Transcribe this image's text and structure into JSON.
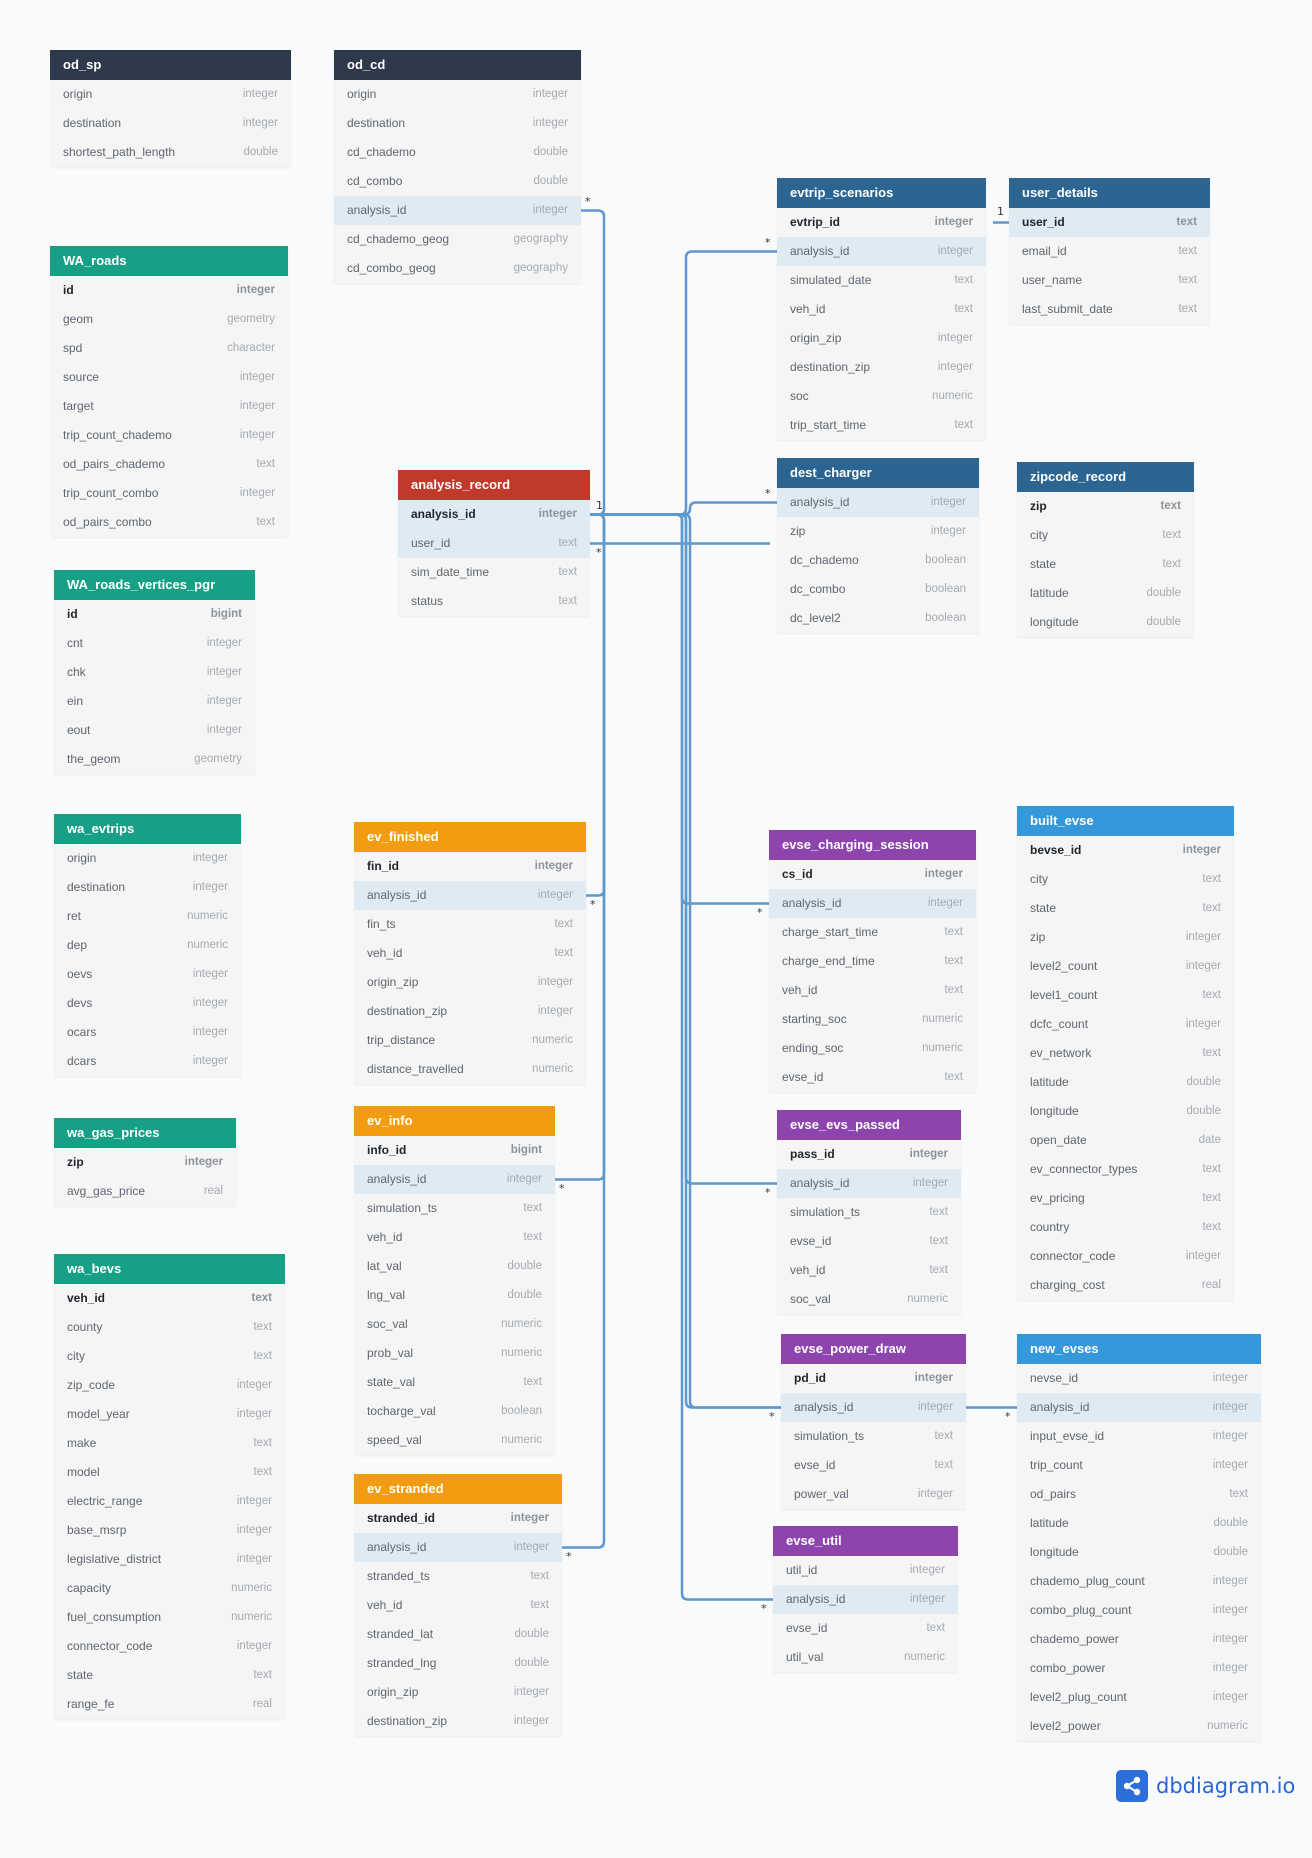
{
  "colors": {
    "navy": "#2e3a4b",
    "teal": "#17a085",
    "red": "#c0392b",
    "blue": "#2c6592",
    "orange": "#f39c12",
    "purple": "#8e44ad",
    "sky": "#3498db",
    "line": "#5e98cd"
  },
  "tables": [
    {
      "key": "od_sp",
      "name": "od_sp",
      "color": "navy",
      "columns": [
        {
          "name": "origin",
          "type": "integer"
        },
        {
          "name": "destination",
          "type": "integer"
        },
        {
          "name": "shortest_path_length",
          "type": "double"
        }
      ]
    },
    {
      "key": "od_cd",
      "name": "od_cd",
      "color": "navy",
      "columns": [
        {
          "name": "origin",
          "type": "integer"
        },
        {
          "name": "destination",
          "type": "integer"
        },
        {
          "name": "cd_chademo",
          "type": "double"
        },
        {
          "name": "cd_combo",
          "type": "double"
        },
        {
          "name": "analysis_id",
          "type": "integer",
          "hl": true
        },
        {
          "name": "cd_chademo_geog",
          "type": "geography"
        },
        {
          "name": "cd_combo_geog",
          "type": "geography"
        }
      ]
    },
    {
      "key": "evtrip_scenarios",
      "name": "evtrip_scenarios",
      "color": "blue",
      "columns": [
        {
          "name": "evtrip_id",
          "type": "integer",
          "pk": true
        },
        {
          "name": "analysis_id",
          "type": "integer",
          "hl": true
        },
        {
          "name": "simulated_date",
          "type": "text"
        },
        {
          "name": "veh_id",
          "type": "text"
        },
        {
          "name": "origin_zip",
          "type": "integer"
        },
        {
          "name": "destination_zip",
          "type": "integer"
        },
        {
          "name": "soc",
          "type": "numeric"
        },
        {
          "name": "trip_start_time",
          "type": "text"
        }
      ]
    },
    {
      "key": "user_details",
      "name": "user_details",
      "color": "blue",
      "columns": [
        {
          "name": "user_id",
          "type": "text",
          "pk": true,
          "hl": true
        },
        {
          "name": "email_id",
          "type": "text"
        },
        {
          "name": "user_name",
          "type": "text"
        },
        {
          "name": "last_submit_date",
          "type": "text"
        }
      ]
    },
    {
      "key": "WA_roads",
      "name": "WA_roads",
      "color": "teal",
      "columns": [
        {
          "name": "id",
          "type": "integer",
          "pk": true
        },
        {
          "name": "geom",
          "type": "geometry"
        },
        {
          "name": "spd",
          "type": "character"
        },
        {
          "name": "source",
          "type": "integer"
        },
        {
          "name": "target",
          "type": "integer"
        },
        {
          "name": "trip_count_chademo",
          "type": "integer"
        },
        {
          "name": "od_pairs_chademo",
          "type": "text"
        },
        {
          "name": "trip_count_combo",
          "type": "integer"
        },
        {
          "name": "od_pairs_combo",
          "type": "text"
        }
      ]
    },
    {
      "key": "analysis_record",
      "name": "analysis_record",
      "color": "red",
      "columns": [
        {
          "name": "analysis_id",
          "type": "integer",
          "pk": true,
          "hl": true
        },
        {
          "name": "user_id",
          "type": "text",
          "hl": true
        },
        {
          "name": "sim_date_time",
          "type": "text"
        },
        {
          "name": "status",
          "type": "text"
        }
      ]
    },
    {
      "key": "dest_charger",
      "name": "dest_charger",
      "color": "blue",
      "columns": [
        {
          "name": "analysis_id",
          "type": "integer",
          "hl": true
        },
        {
          "name": "zip",
          "type": "integer"
        },
        {
          "name": "dc_chademo",
          "type": "boolean"
        },
        {
          "name": "dc_combo",
          "type": "boolean"
        },
        {
          "name": "dc_level2",
          "type": "boolean"
        }
      ]
    },
    {
      "key": "zipcode_record",
      "name": "zipcode_record",
      "color": "blue",
      "columns": [
        {
          "name": "zip",
          "type": "text",
          "pk": true
        },
        {
          "name": "city",
          "type": "text"
        },
        {
          "name": "state",
          "type": "text"
        },
        {
          "name": "latitude",
          "type": "double"
        },
        {
          "name": "longitude",
          "type": "double"
        }
      ]
    },
    {
      "key": "WA_roads_vertices_pgr",
      "name": "WA_roads_vertices_pgr",
      "color": "teal",
      "columns": [
        {
          "name": "id",
          "type": "bigint",
          "pk": true
        },
        {
          "name": "cnt",
          "type": "integer"
        },
        {
          "name": "chk",
          "type": "integer"
        },
        {
          "name": "ein",
          "type": "integer"
        },
        {
          "name": "eout",
          "type": "integer"
        },
        {
          "name": "the_geom",
          "type": "geometry"
        }
      ]
    },
    {
      "key": "wa_evtrips",
      "name": "wa_evtrips",
      "color": "teal",
      "columns": [
        {
          "name": "origin",
          "type": "integer"
        },
        {
          "name": "destination",
          "type": "integer"
        },
        {
          "name": "ret",
          "type": "numeric"
        },
        {
          "name": "dep",
          "type": "numeric"
        },
        {
          "name": "oevs",
          "type": "integer"
        },
        {
          "name": "devs",
          "type": "integer"
        },
        {
          "name": "ocars",
          "type": "integer"
        },
        {
          "name": "dcars",
          "type": "integer"
        }
      ]
    },
    {
      "key": "ev_finished",
      "name": "ev_finished",
      "color": "orange",
      "columns": [
        {
          "name": "fin_id",
          "type": "integer",
          "pk": true
        },
        {
          "name": "analysis_id",
          "type": "integer",
          "hl": true
        },
        {
          "name": "fin_ts",
          "type": "text"
        },
        {
          "name": "veh_id",
          "type": "text"
        },
        {
          "name": "origin_zip",
          "type": "integer"
        },
        {
          "name": "destination_zip",
          "type": "integer"
        },
        {
          "name": "trip_distance",
          "type": "numeric"
        },
        {
          "name": "distance_travelled",
          "type": "numeric"
        }
      ]
    },
    {
      "key": "evse_charging_session",
      "name": "evse_charging_session",
      "color": "purple",
      "columns": [
        {
          "name": "cs_id",
          "type": "integer",
          "pk": true
        },
        {
          "name": "analysis_id",
          "type": "integer",
          "hl": true
        },
        {
          "name": "charge_start_time",
          "type": "text"
        },
        {
          "name": "charge_end_time",
          "type": "text"
        },
        {
          "name": "veh_id",
          "type": "text"
        },
        {
          "name": "starting_soc",
          "type": "numeric"
        },
        {
          "name": "ending_soc",
          "type": "numeric"
        },
        {
          "name": "evse_id",
          "type": "text"
        }
      ]
    },
    {
      "key": "built_evse",
      "name": "built_evse",
      "color": "sky",
      "columns": [
        {
          "name": "bevse_id",
          "type": "integer",
          "pk": true
        },
        {
          "name": "city",
          "type": "text"
        },
        {
          "name": "state",
          "type": "text"
        },
        {
          "name": "zip",
          "type": "integer"
        },
        {
          "name": "level2_count",
          "type": "integer"
        },
        {
          "name": "level1_count",
          "type": "text"
        },
        {
          "name": "dcfc_count",
          "type": "integer"
        },
        {
          "name": "ev_network",
          "type": "text"
        },
        {
          "name": "latitude",
          "type": "double"
        },
        {
          "name": "longitude",
          "type": "double"
        },
        {
          "name": "open_date",
          "type": "date"
        },
        {
          "name": "ev_connector_types",
          "type": "text"
        },
        {
          "name": "ev_pricing",
          "type": "text"
        },
        {
          "name": "country",
          "type": "text"
        },
        {
          "name": "connector_code",
          "type": "integer"
        },
        {
          "name": "charging_cost",
          "type": "real"
        }
      ]
    },
    {
      "key": "wa_gas_prices",
      "name": "wa_gas_prices",
      "color": "teal",
      "columns": [
        {
          "name": "zip",
          "type": "integer",
          "pk": true
        },
        {
          "name": "avg_gas_price",
          "type": "real"
        }
      ]
    },
    {
      "key": "ev_info",
      "name": "ev_info",
      "color": "orange",
      "columns": [
        {
          "name": "info_id",
          "type": "bigint",
          "pk": true
        },
        {
          "name": "analysis_id",
          "type": "integer",
          "hl": true
        },
        {
          "name": "simulation_ts",
          "type": "text"
        },
        {
          "name": "veh_id",
          "type": "text"
        },
        {
          "name": "lat_val",
          "type": "double"
        },
        {
          "name": "lng_val",
          "type": "double"
        },
        {
          "name": "soc_val",
          "type": "numeric"
        },
        {
          "name": "prob_val",
          "type": "numeric"
        },
        {
          "name": "state_val",
          "type": "text"
        },
        {
          "name": "tocharge_val",
          "type": "boolean"
        },
        {
          "name": "speed_val",
          "type": "numeric"
        }
      ]
    },
    {
      "key": "evse_evs_passed",
      "name": "evse_evs_passed",
      "color": "purple",
      "columns": [
        {
          "name": "pass_id",
          "type": "integer",
          "pk": true
        },
        {
          "name": "analysis_id",
          "type": "integer",
          "hl": true
        },
        {
          "name": "simulation_ts",
          "type": "text"
        },
        {
          "name": "evse_id",
          "type": "text"
        },
        {
          "name": "veh_id",
          "type": "text"
        },
        {
          "name": "soc_val",
          "type": "numeric"
        }
      ]
    },
    {
      "key": "wa_bevs",
      "name": "wa_bevs",
      "color": "teal",
      "columns": [
        {
          "name": "veh_id",
          "type": "text",
          "pk": true
        },
        {
          "name": "county",
          "type": "text"
        },
        {
          "name": "city",
          "type": "text"
        },
        {
          "name": "zip_code",
          "type": "integer"
        },
        {
          "name": "model_year",
          "type": "integer"
        },
        {
          "name": "make",
          "type": "text"
        },
        {
          "name": "model",
          "type": "text"
        },
        {
          "name": "electric_range",
          "type": "integer"
        },
        {
          "name": "base_msrp",
          "type": "integer"
        },
        {
          "name": "legislative_district",
          "type": "integer"
        },
        {
          "name": "capacity",
          "type": "numeric"
        },
        {
          "name": "fuel_consumption",
          "type": "numeric"
        },
        {
          "name": "connector_code",
          "type": "integer"
        },
        {
          "name": "state",
          "type": "text"
        },
        {
          "name": "range_fe",
          "type": "real"
        }
      ]
    },
    {
      "key": "evse_power_draw",
      "name": "evse_power_draw",
      "color": "purple",
      "columns": [
        {
          "name": "pd_id",
          "type": "integer",
          "pk": true
        },
        {
          "name": "analysis_id",
          "type": "integer",
          "hl": true
        },
        {
          "name": "simulation_ts",
          "type": "text"
        },
        {
          "name": "evse_id",
          "type": "text"
        },
        {
          "name": "power_val",
          "type": "integer"
        }
      ]
    },
    {
      "key": "new_evses",
      "name": "new_evses",
      "color": "sky",
      "columns": [
        {
          "name": "nevse_id",
          "type": "integer"
        },
        {
          "name": "analysis_id",
          "type": "integer",
          "hl": true
        },
        {
          "name": "input_evse_id",
          "type": "integer"
        },
        {
          "name": "trip_count",
          "type": "integer"
        },
        {
          "name": "od_pairs",
          "type": "text"
        },
        {
          "name": "latitude",
          "type": "double"
        },
        {
          "name": "longitude",
          "type": "double"
        },
        {
          "name": "chademo_plug_count",
          "type": "integer"
        },
        {
          "name": "combo_plug_count",
          "type": "integer"
        },
        {
          "name": "chademo_power",
          "type": "integer"
        },
        {
          "name": "combo_power",
          "type": "integer"
        },
        {
          "name": "level2_plug_count",
          "type": "integer"
        },
        {
          "name": "level2_power",
          "type": "numeric"
        }
      ]
    },
    {
      "key": "ev_stranded",
      "name": "ev_stranded",
      "color": "orange",
      "columns": [
        {
          "name": "stranded_id",
          "type": "integer",
          "pk": true
        },
        {
          "name": "analysis_id",
          "type": "integer",
          "hl": true
        },
        {
          "name": "stranded_ts",
          "type": "text"
        },
        {
          "name": "veh_id",
          "type": "text"
        },
        {
          "name": "stranded_lat",
          "type": "double"
        },
        {
          "name": "stranded_lng",
          "type": "double"
        },
        {
          "name": "origin_zip",
          "type": "integer"
        },
        {
          "name": "destination_zip",
          "type": "integer"
        }
      ]
    },
    {
      "key": "evse_util",
      "name": "evse_util",
      "color": "purple",
      "columns": [
        {
          "name": "util_id",
          "type": "integer"
        },
        {
          "name": "analysis_id",
          "type": "integer",
          "hl": true
        },
        {
          "name": "evse_id",
          "type": "text"
        },
        {
          "name": "util_val",
          "type": "numeric"
        }
      ]
    }
  ],
  "relationships": [
    {
      "from": "analysis_record.analysis_id",
      "to": "od_cd.analysis_id",
      "from_card": "1",
      "to_card": "*"
    },
    {
      "from": "analysis_record.analysis_id",
      "to": "evtrip_scenarios.analysis_id",
      "from_card": "1",
      "to_card": "*"
    },
    {
      "from": "analysis_record.analysis_id",
      "to": "dest_charger.analysis_id",
      "from_card": "1",
      "to_card": "*"
    },
    {
      "from": "analysis_record.analysis_id",
      "to": "ev_finished.analysis_id",
      "from_card": "1",
      "to_card": "*"
    },
    {
      "from": "analysis_record.analysis_id",
      "to": "ev_info.analysis_id",
      "from_card": "1",
      "to_card": "*"
    },
    {
      "from": "analysis_record.analysis_id",
      "to": "ev_stranded.analysis_id",
      "from_card": "1",
      "to_card": "*"
    },
    {
      "from": "analysis_record.analysis_id",
      "to": "evse_charging_session.analysis_id",
      "from_card": "1",
      "to_card": "*"
    },
    {
      "from": "analysis_record.analysis_id",
      "to": "evse_evs_passed.analysis_id",
      "from_card": "1",
      "to_card": "*"
    },
    {
      "from": "analysis_record.analysis_id",
      "to": "evse_power_draw.analysis_id",
      "from_card": "1",
      "to_card": "*"
    },
    {
      "from": "analysis_record.analysis_id",
      "to": "evse_util.analysis_id",
      "from_card": "1",
      "to_card": "*"
    },
    {
      "from": "analysis_record.analysis_id",
      "to": "new_evses.analysis_id",
      "from_card": "1",
      "to_card": "*"
    },
    {
      "from": "user_details.user_id",
      "to": "analysis_record.user_id",
      "from_card": "1",
      "to_card": "*"
    }
  ],
  "brand": {
    "name": "dbdiagram.io",
    "icon": "share-icon"
  }
}
